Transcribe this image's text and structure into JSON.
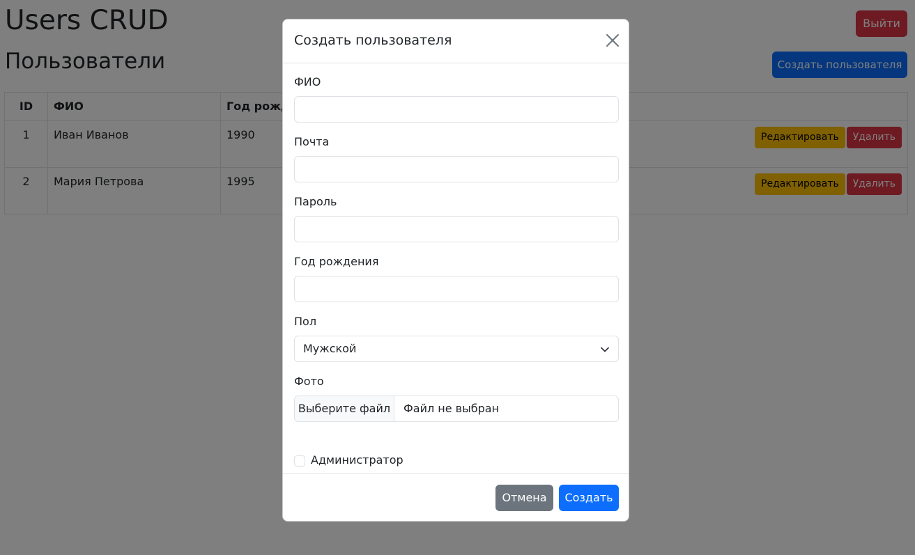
{
  "header": {
    "title": "Users CRUD",
    "logout_label": "Выйти"
  },
  "section": {
    "title": "Пользователи",
    "create_label": "Создать пользователя"
  },
  "table": {
    "columns": [
      "ID",
      "ФИО",
      "Год рожде"
    ],
    "rows": [
      {
        "id": "1",
        "name": "Иван Иванов",
        "year": "1990",
        "edit_label": "Редактировать",
        "delete_label": "Удалить"
      },
      {
        "id": "2",
        "name": "Мария Петрова",
        "year": "1995",
        "edit_label": "Редактировать",
        "delete_label": "Удалить"
      }
    ]
  },
  "modal": {
    "title": "Создать пользователя",
    "fields": {
      "fio": {
        "label": "ФИО",
        "value": ""
      },
      "email": {
        "label": "Почта",
        "value": ""
      },
      "password": {
        "label": "Пароль",
        "value": ""
      },
      "birth_year": {
        "label": "Год рождения",
        "value": ""
      },
      "gender": {
        "label": "Пол",
        "selected": "Мужской"
      },
      "photo": {
        "label": "Фото",
        "button_label": "Выберите файл",
        "status": "Файл не выбран"
      },
      "admin": {
        "label": "Администратор"
      }
    },
    "cancel_label": "Отмена",
    "submit_label": "Создать"
  },
  "icons": {
    "close": "close-icon",
    "select": "chevron-down-icon"
  },
  "colors": {
    "primary": "#0d6efd",
    "danger": "#dc3545",
    "warning": "#ffc107",
    "secondary": "#6c757d"
  }
}
